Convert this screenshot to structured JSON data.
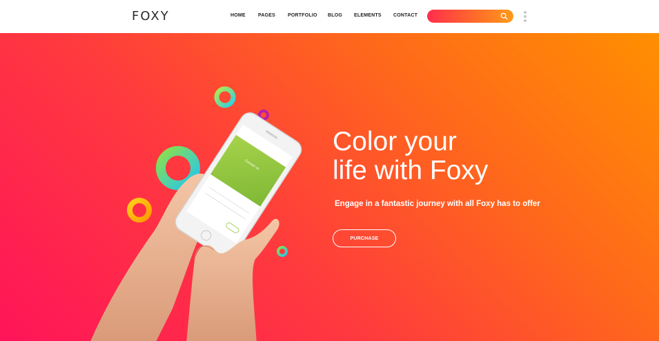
{
  "brand": {
    "logo": "FOXY"
  },
  "nav": {
    "items": [
      {
        "label": "HOME"
      },
      {
        "label": "PAGES"
      },
      {
        "label": "PORTFOLIO"
      },
      {
        "label": "BLOG"
      },
      {
        "label": "ELEMENTS"
      },
      {
        "label": "CONTACT"
      }
    ]
  },
  "search": {
    "placeholder": "",
    "value": ""
  },
  "hero": {
    "title_line1": "Color your",
    "title_line2": "life with Foxy",
    "subtitle": "Engage in a fantastic journey with all Foxy has to offer",
    "button_label": "PURCHASE",
    "phone_screen_title": "Contact us"
  },
  "colors": {
    "gradient_start": "#ff1459",
    "gradient_mid": "#ff3a3e",
    "gradient_end": "#ff8f00",
    "text": "#222222",
    "accent_green": "#8cc63f"
  },
  "icons": {
    "search": "search-icon",
    "more": "more-vertical-icon"
  }
}
